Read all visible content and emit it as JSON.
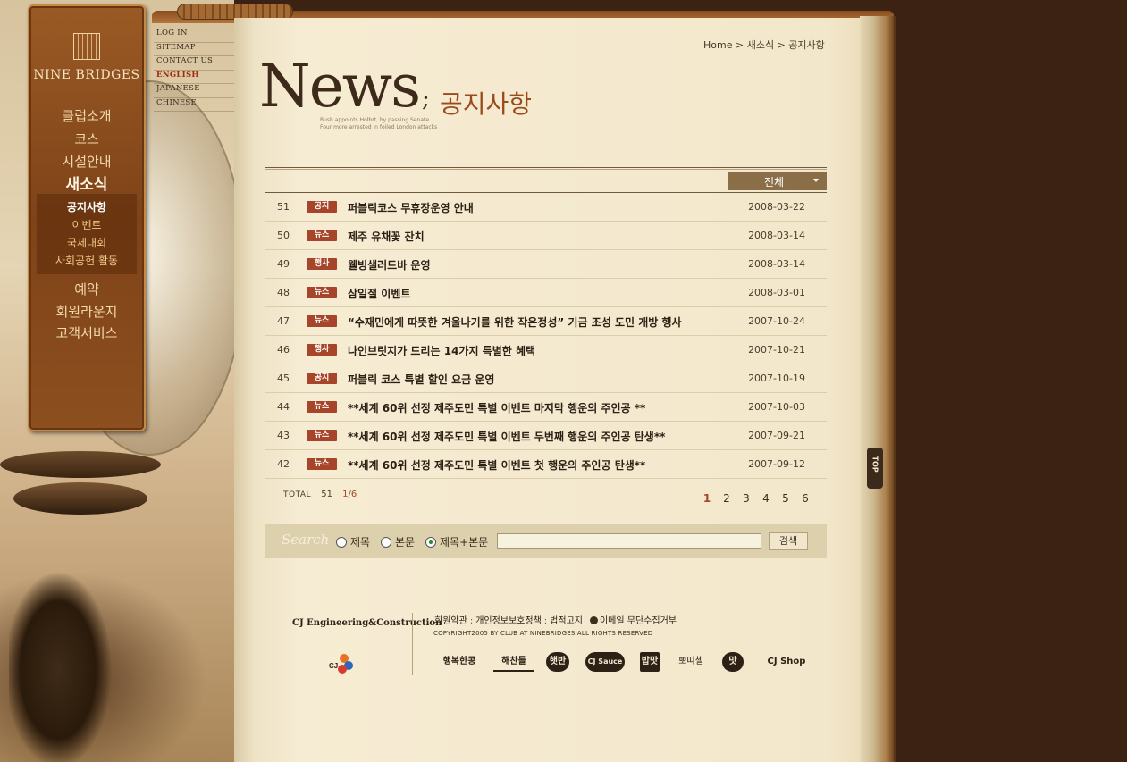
{
  "brand": {
    "logo_text": "NINE BRIDGES"
  },
  "main_nav": [
    {
      "label": "클럽소개"
    },
    {
      "label": "코스"
    },
    {
      "label": "시설안내"
    },
    {
      "label": "새소식",
      "active": true
    },
    {
      "label": "예약"
    },
    {
      "label": "회원라운지"
    },
    {
      "label": "고객서비스"
    }
  ],
  "sub_nav": [
    {
      "label": "공지사항",
      "active": true
    },
    {
      "label": "이벤트"
    },
    {
      "label": "국제대회"
    },
    {
      "label": "사회공헌 활동"
    }
  ],
  "util_links": [
    {
      "label": "LOG IN"
    },
    {
      "label": "SITEMAP"
    },
    {
      "label": "CONTACT US"
    },
    {
      "label": "ENGLISH",
      "active": true
    },
    {
      "label": "JAPANESE"
    },
    {
      "label": "CHINESE"
    }
  ],
  "breadcrumb": {
    "home": "Home",
    "sep1": ">",
    "section": "새소식",
    "sep2": ">",
    "page": "공지사항"
  },
  "heading": {
    "big": "News",
    "semi": ";",
    "ko": "공지사항",
    "tagline_1": "Bush appoints Holbrt, by passing Senate",
    "tagline_2": "Four more arrested in foiled London attacks"
  },
  "category_select": {
    "value": "전체"
  },
  "news": [
    {
      "num": "51",
      "type": "공지",
      "title": "퍼블릭코스 무휴장운영 안내",
      "date": "2008-03-22"
    },
    {
      "num": "50",
      "type": "뉴스",
      "title": "제주 유채꽃 잔치",
      "date": "2008-03-14"
    },
    {
      "num": "49",
      "type": "행사",
      "title": "웰빙샐러드바 운영",
      "date": "2008-03-14"
    },
    {
      "num": "48",
      "type": "뉴스",
      "title": "삼일절 이벤트",
      "date": "2008-03-01"
    },
    {
      "num": "47",
      "type": "뉴스",
      "title": "“수재민에게 따뜻한 겨울나기를 위한 작은정성” 기금 조성 도민 개방 행사",
      "date": "2007-10-24"
    },
    {
      "num": "46",
      "type": "행사",
      "title": "나인브릿지가 드리는 14가지 특별한 혜택",
      "date": "2007-10-21"
    },
    {
      "num": "45",
      "type": "공지",
      "title": "퍼블릭 코스 특별 할인 요금 운영",
      "date": "2007-10-19"
    },
    {
      "num": "44",
      "type": "뉴스",
      "title": "**세계 60위 선정 제주도민 특별 이벤트 마지막 행운의 주인공 **",
      "date": "2007-10-03"
    },
    {
      "num": "43",
      "type": "뉴스",
      "title": "**세계 60위 선정 제주도민 특별 이벤트 두번째 행운의 주인공 탄생**",
      "date": "2007-09-21"
    },
    {
      "num": "42",
      "type": "뉴스",
      "title": "**세계 60위 선정 제주도민 특별 이벤트 첫 행운의 주인공 탄생**",
      "date": "2007-09-12"
    }
  ],
  "total": {
    "label": "TOTAL",
    "count": "51",
    "page_current": "1",
    "page_total": "/6"
  },
  "pages": [
    "1",
    "2",
    "3",
    "4",
    "5",
    "6"
  ],
  "current_page": "1",
  "search": {
    "label": "Search",
    "options": [
      {
        "label": "제목",
        "checked": false
      },
      {
        "label": "본문",
        "checked": false
      },
      {
        "label": "제목+본문",
        "checked": true
      }
    ],
    "input_value": "",
    "button_label": "검색"
  },
  "footer": {
    "company": "CJ Engineering&Construction",
    "cj_logo_text": "CJ",
    "links": [
      "회원약관",
      "개인정보보호정책",
      "법적고지",
      "이메일 무단수집거부"
    ],
    "link_sep": ":",
    "copyright": "COPYRIGHT2005 BY CLUB AT NINEBRIDGES ALL RIGHTS RESERVED",
    "brands": [
      "행복한콩",
      "해찬들",
      "햇반",
      "CJ Sauce",
      "밥맛",
      "뽀띠첼",
      "맛",
      "CJ Shop"
    ]
  },
  "top_button": {
    "label": "TOP"
  },
  "colors": {
    "accent": "#a6452a",
    "nav_panel": "#8c4f1f",
    "page": "#f3e7cb",
    "background": "#3b2212"
  }
}
